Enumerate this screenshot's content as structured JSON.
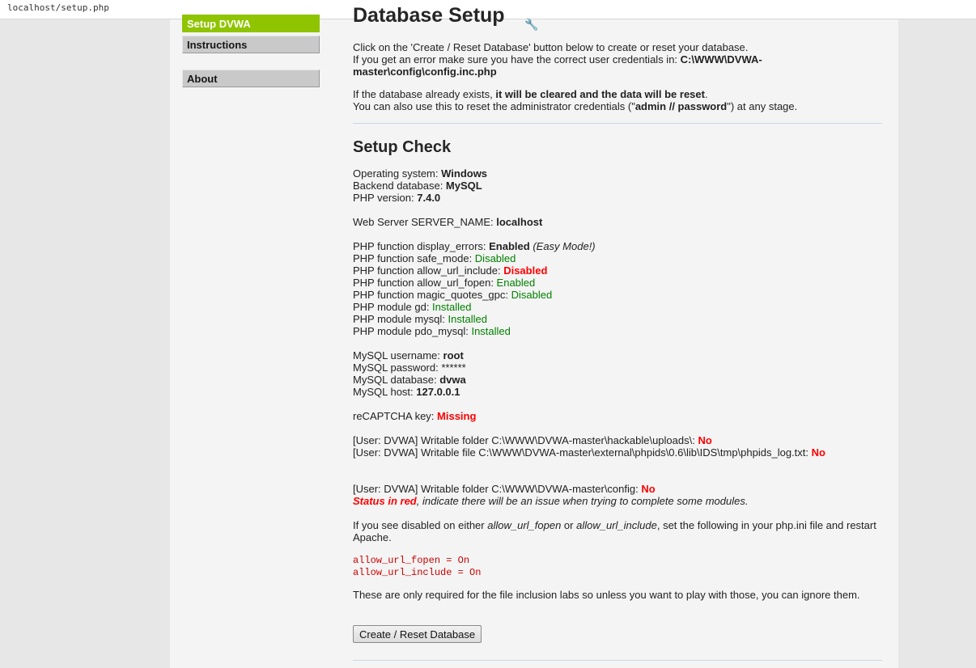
{
  "browser": {
    "url": "localhost/setup.php"
  },
  "menu": {
    "setup": "Setup DVWA",
    "instructions": "Instructions",
    "about": "About"
  },
  "header": {
    "title": "Database Setup",
    "intro1": "Click on the 'Create / Reset Database' button below to create or reset your database.",
    "intro2_prefix": "If you get an error make sure you have the correct user credentials in: ",
    "intro2_path": "C:\\WWW\\DVWA-master\\config\\config.inc.php",
    "reset1_prefix": "If the database already exists, ",
    "reset1_bold": "it will be cleared and the data will be reset",
    "reset1_suffix": ".",
    "reset2_prefix": "You can also use this to reset the administrator credentials (\"",
    "reset2_bold": "admin // password",
    "reset2_suffix": "\") at any stage."
  },
  "check": {
    "title": "Setup Check",
    "os_label": "Operating system: ",
    "os_value": "Windows",
    "db_label": "Backend database: ",
    "db_value": "MySQL",
    "php_label": "PHP version: ",
    "php_value": "7.4.0",
    "server_label": "Web Server SERVER_NAME: ",
    "server_value": "localhost",
    "display_errors_label": "PHP function display_errors: ",
    "display_errors_value": "Enabled",
    "display_errors_note": "(Easy Mode!)",
    "safe_mode_label": "PHP function safe_mode: ",
    "safe_mode_value": "Disabled",
    "url_include_label": "PHP function allow_url_include: ",
    "url_include_value": "Disabled",
    "url_fopen_label": "PHP function allow_url_fopen: ",
    "url_fopen_value": "Enabled",
    "magic_quotes_label": "PHP function magic_quotes_gpc: ",
    "magic_quotes_value": "Disabled",
    "gd_label": "PHP module gd: ",
    "gd_value": "Installed",
    "mysql_label": "PHP module mysql: ",
    "mysql_value": "Installed",
    "pdo_label": "PHP module pdo_mysql: ",
    "pdo_value": "Installed",
    "user_label": "MySQL username: ",
    "user_value": "root",
    "pass_label": "MySQL password: ",
    "pass_value": "******",
    "dbname_label": "MySQL database: ",
    "dbname_value": "dvwa",
    "host_label": "MySQL host: ",
    "host_value": "127.0.0.1",
    "recaptcha_label": "reCAPTCHA key: ",
    "recaptcha_value": "Missing",
    "uploads_label": "[User: DVWA] Writable folder C:\\WWW\\DVWA-master\\hackable\\uploads\\: ",
    "uploads_value": "No",
    "phpids_label": "[User: DVWA] Writable file C:\\WWW\\DVWA-master\\external\\phpids\\0.6\\lib\\IDS\\tmp\\phpids_log.txt: ",
    "phpids_value": "No",
    "config_label": "[User: DVWA] Writable folder C:\\WWW\\DVWA-master\\config: ",
    "config_value": "No",
    "status_red": "Status in red",
    "status_note": ", indicate there will be an issue when trying to complete some modules.",
    "disabled_prefix": "If you see disabled on either ",
    "disabled_em1": "allow_url_fopen",
    "disabled_or": " or ",
    "disabled_em2": "allow_url_include",
    "disabled_suffix": ", set the following in your php.ini file and restart Apache.",
    "code1": "allow_url_fopen = On",
    "code2": "allow_url_include = On",
    "only_required": "These are only required for the file inclusion labs so unless you want to play with those, you can ignore them."
  },
  "actions": {
    "create_reset": "Create / Reset Database"
  },
  "colors": {
    "ok": "#008000",
    "bad": "#ff0000",
    "menu_selected": "#8fc400"
  }
}
